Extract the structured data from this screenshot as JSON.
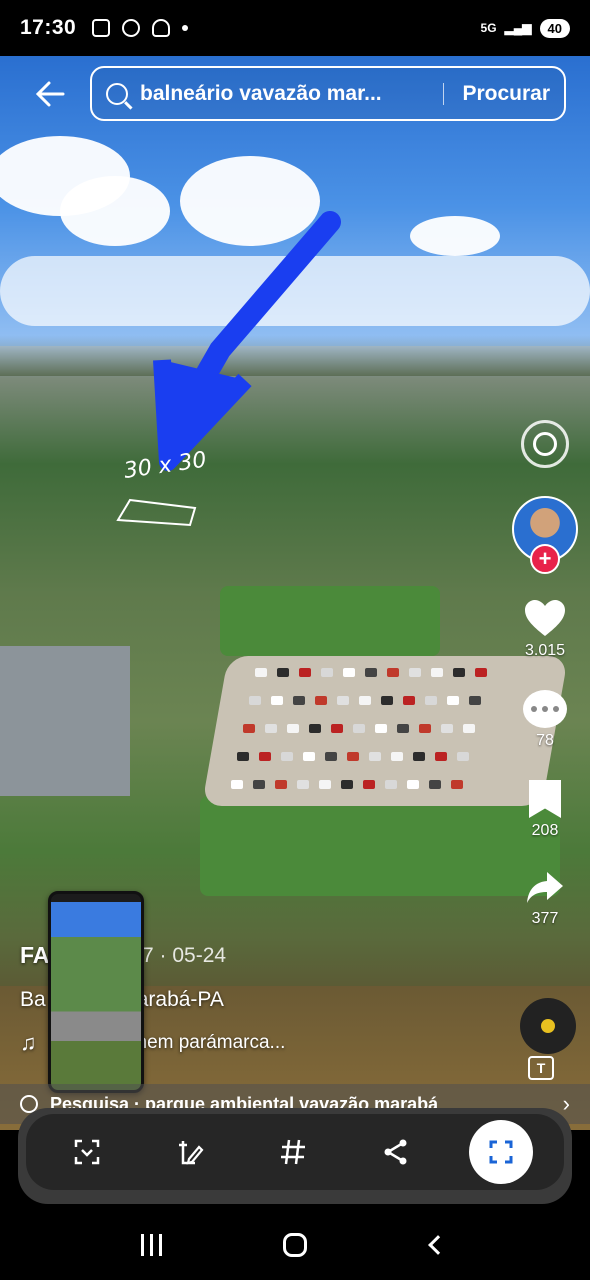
{
  "status_bar": {
    "time": "17:30",
    "network": "5G",
    "battery": "40"
  },
  "search": {
    "query": "balneário vavazão mar...",
    "button": "Procurar"
  },
  "annotation": {
    "handwritten_text": "30 x 30",
    "color": "#1a3ef0"
  },
  "rail": {
    "likes": "3.015",
    "comments": "78",
    "saves": "208",
    "shares": "377"
  },
  "caption": {
    "author": "FA",
    "date": "7 · 05-24",
    "text": "Ba      vazão, Marabá-PA",
    "music": "nem parámarca..."
  },
  "suggestion": {
    "prefix": "Pesquisa",
    "text": "parque ambiental vavazão marabá"
  },
  "toolbar": {
    "items": [
      "scan-icon",
      "edit-icon",
      "hashtag-icon",
      "share-icon",
      "select-icon"
    ]
  },
  "colors": {
    "accent_red": "#e8234a",
    "sky": "#2a6fd0"
  }
}
